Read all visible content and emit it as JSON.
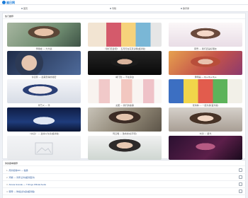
{
  "app": {
    "logo_text": "遍日网"
  },
  "nav": {
    "items": [
      {
        "label": "首页"
      },
      {
        "label": "专辑"
      },
      {
        "label": "歌手库"
      }
    ]
  },
  "hot_section": {
    "title": "热门推荐",
    "cards": [
      {
        "caption": "李易峰 — 大大镜"
      },
      {
        "caption": "《我们恋爱吧》 · 五月天在东京演唱(超清版)"
      },
      {
        "caption": "韩雪 — 我们还是好朋友"
      },
      {
        "caption": "许嵩家 — 最美安静的秘密"
      },
      {
        "caption": "胡门瑶 — 不在身边"
      },
      {
        "caption": "黄明昊 — Bye Bye Bye"
      },
      {
        "caption": "张艺兴 — 汤"
      },
      {
        "caption": "女团 — 我们的故事"
      },
      {
        "caption": "张海林 — 一起为我(官方版)"
      },
      {
        "caption": "《许嵩》 — 爱情以为点(超清版)"
      },
      {
        "caption": "阿云嘎 — 致青春(好声音)"
      },
      {
        "caption": "刘涛 — 星光"
      },
      {
        "caption": "黄云朵 — 天亮以后"
      },
      {
        "caption": "黄子韬 — 感到这首歌(官方)"
      },
      {
        "caption": "杨紫清 — 在你"
      }
    ]
  },
  "list_section": {
    "title": "你的歌单推荐",
    "items": [
      {
        "num": "1.",
        "title": "周杰伦新MV — 稻香"
      },
      {
        "num": "2.",
        "title": "邓紫 — 光年之外(超清官方)"
      },
      {
        "num": "3.",
        "title": "Ariana Grande — 7 Rings Official Audio"
      },
      {
        "num": "4.",
        "title": "韩雪 — 你说过许多(超清版)"
      }
    ]
  },
  "colors": {
    "accent": "#1a7cd9",
    "link": "#2d5a9c"
  }
}
